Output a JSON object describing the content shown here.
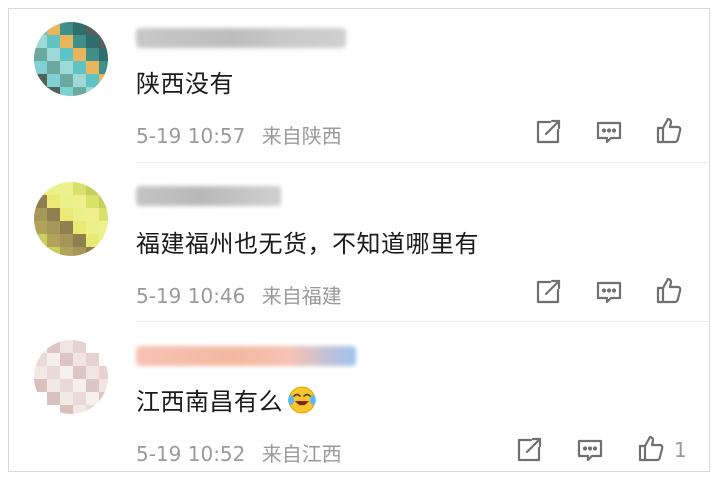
{
  "comments": [
    {
      "content": "陕西没有",
      "time": "5-19 10:57",
      "location": "来自陕西",
      "likes": "",
      "avatar_colors": [
        "#5fc3c5",
        "#7fd0d0",
        "#3f8f8a",
        "#9fd9d6",
        "#555f5c",
        "#e8b45c",
        "#6aa8a0",
        "#2f6e6a"
      ],
      "name_colors": [
        "#c8c8c8",
        "#bdbdbd",
        "#d0d0d0"
      ]
    },
    {
      "content": "福建福州也无货，不知道哪里有",
      "time": "5-19 10:46",
      "location": "来自福建",
      "likes": "",
      "avatar_colors": [
        "#d8e26a",
        "#e9ea76",
        "#b2a35a",
        "#f0ef8d",
        "#8f7f4f",
        "#c9cf5e",
        "#eaf08a",
        "#a69657"
      ],
      "name_colors": [
        "#c4c4c4",
        "#b8b8b8",
        "#cfcfcf"
      ]
    },
    {
      "content": "江西南昌有么",
      "time": "5-19 10:52",
      "location": "来自江西",
      "likes": "1",
      "avatar_colors": [
        "#f0e9e6",
        "#e6d2cf",
        "#f5efed",
        "#d9c0bc",
        "#f2e4e1",
        "#e9dad7",
        "#ffffff",
        "#dcc6c3"
      ],
      "name_colors": [
        "#f6c2b3",
        "#f3b9a0",
        "#9bc3f0"
      ]
    }
  ],
  "icons": {
    "repost": "repost-icon",
    "comment": "comment-icon",
    "like": "like-icon",
    "emoji": "crying-laughing-emoji-icon"
  },
  "colors": {
    "text": "#1a1a1a",
    "meta": "#9a9a9a",
    "icon": "#707070"
  }
}
